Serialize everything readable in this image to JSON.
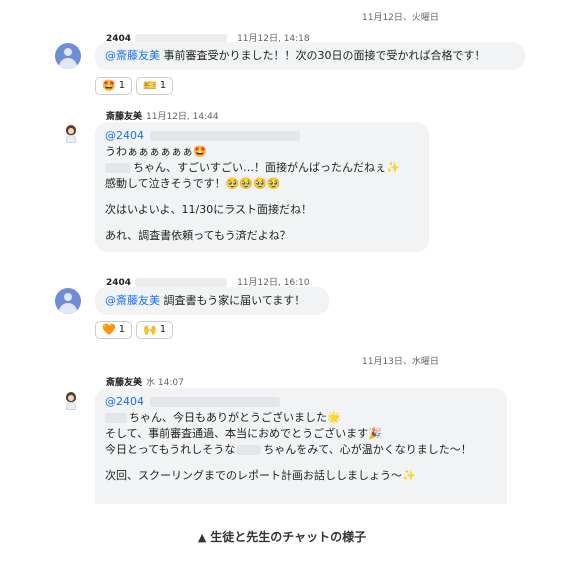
{
  "date_separators": [
    "11月12日、火曜日",
    "11月13日、水曜日"
  ],
  "messages": [
    {
      "sender": "2404",
      "time": "11月12日, 14:18",
      "mention": "@斎藤友美",
      "text": " 事前審査受かりました！！次の30日の面接で受かれば合格です！",
      "reactions": [
        {
          "emoji": "🤩",
          "count": "1",
          "icon": "star-struck-icon"
        },
        {
          "emoji": "🎫",
          "count": "1",
          "icon": "ticket-icon"
        }
      ]
    },
    {
      "sender": "斎藤友美",
      "time": "11月12日, 14:44",
      "mention": "@2404",
      "lines": [
        "うわぁぁぁぁぁぁ🤩",
        "ちゃん、すごいすごい…！面接がんばったんだねぇ✨",
        "感動して泣きそうです！🥹🥹🥹🥹",
        "次はいよいよ、11/30にラスト面接だね！",
        "あれ、調査書依頼ってもう済だよね？"
      ]
    },
    {
      "sender": "2404",
      "time": "11月12日, 16:10",
      "mention": "@斎藤友美",
      "text": " 調査書もう家に届いてます！",
      "reactions": [
        {
          "emoji": "🧡",
          "count": "1",
          "icon": "orange-heart-icon"
        },
        {
          "emoji": "🙌",
          "count": "1",
          "icon": "raising-hands-icon"
        }
      ]
    },
    {
      "sender": "斎藤友美",
      "time": "水 14:07",
      "mention": "@2404",
      "lines": [
        "ちゃん、今日もありがとうございました🌟",
        "そして、事前審査通過、本当におめでとうございます🎉",
        "今日とってもうれしそうな",
        "ちゃんをみて、心が温かくなりました〜！",
        "次回、スクーリングまでのレポート計画お話ししましょう〜✨"
      ]
    }
  ],
  "caption": {
    "triangle": "▲",
    "text": "生徒と先生のチャットの様子"
  }
}
